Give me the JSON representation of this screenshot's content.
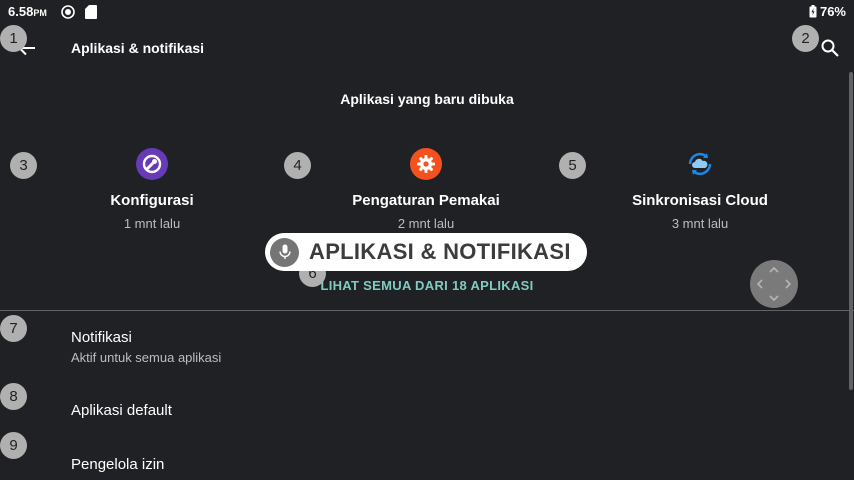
{
  "status_bar": {
    "time": "6.58",
    "ampm": "PM",
    "battery": "76%"
  },
  "toolbar": {
    "title": "Aplikasi & notifikasi",
    "back_icon": "arrow-left-icon",
    "search_icon": "search-icon"
  },
  "recent": {
    "heading": "Aplikasi yang baru dibuka",
    "apps": [
      {
        "name": "Konfigurasi",
        "time": "1 mnt lalu",
        "icon": "wrench-icon",
        "color": "#673ab7"
      },
      {
        "name": "Pengaturan Pemakai",
        "time": "2 mnt lalu",
        "icon": "gear-icon",
        "color": "#f4511e"
      },
      {
        "name": "Sinkronisasi Cloud",
        "time": "3 mnt lalu",
        "icon": "cloud-sync-icon",
        "color": "#1e88e5"
      }
    ],
    "see_all": "LIHAT SEMUA DARI 18 APLIKASI"
  },
  "list": [
    {
      "title": "Notifikasi",
      "subtitle": "Aktif untuk semua aplikasi"
    },
    {
      "title": "Aplikasi default"
    },
    {
      "title": "Pengelola izin"
    }
  ],
  "voice_overlay": {
    "text": "APLIKASI & NOTIFIKASI",
    "icon": "microphone-icon"
  },
  "badges": [
    "1",
    "2",
    "3",
    "4",
    "5",
    "6",
    "7",
    "8",
    "9"
  ],
  "colors": {
    "background": "#202124",
    "accent": "#80cbc4",
    "badge": "#b0b0b0"
  }
}
